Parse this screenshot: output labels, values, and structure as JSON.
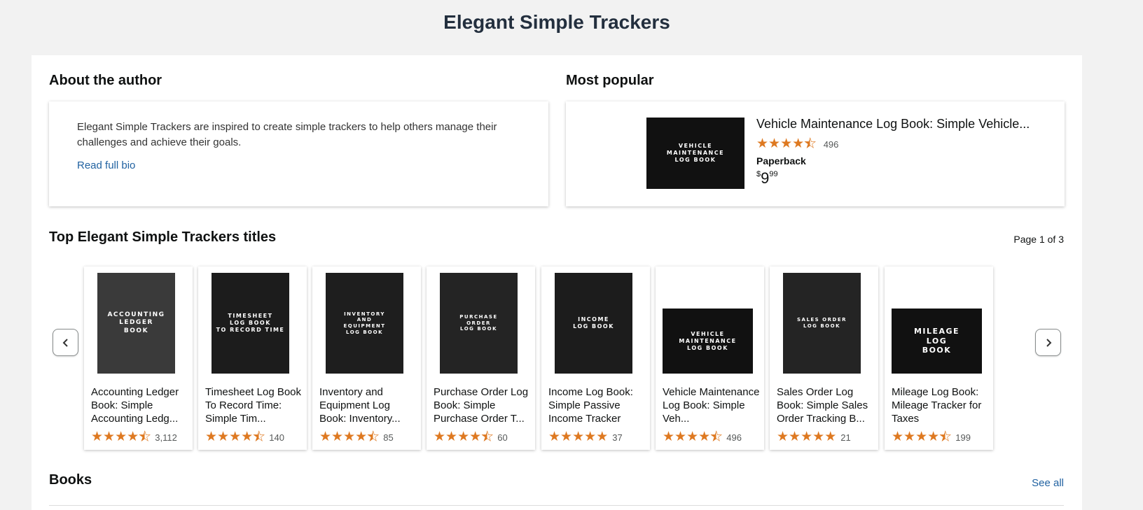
{
  "page_title": "Elegant Simple Trackers",
  "about": {
    "heading": "About the author",
    "bio": "Elegant Simple Trackers are inspired to create simple trackers to help others manage their challenges and achieve their goals.",
    "read_more": "Read full bio"
  },
  "most_popular": {
    "heading": "Most popular",
    "cover_text": "VEHICLE\nMAINTENANCE\nLOG BOOK",
    "title": "Vehicle Maintenance Log Book: Simple Vehicle...",
    "rating": 4.5,
    "rating_count": "496",
    "format": "Paperback",
    "price_symbol": "$",
    "price_whole": "9",
    "price_fraction": "99"
  },
  "top_titles": {
    "heading": "Top Elegant Simple Trackers titles",
    "page_indicator": "Page 1 of 3",
    "items": [
      {
        "title": "Accounting Ledger Book: Simple Accounting Ledg...",
        "cover_text": "ACCOUNTING\nLEDGER\nBOOK",
        "cover_color": "#3a3a3a",
        "rating": 4.5,
        "rating_count": "3,112"
      },
      {
        "title": "Timesheet Log Book To Record Time: Simple Tim...",
        "cover_text": "TIMESHEET\nLOG BOOK\nTO RECORD TIME",
        "cover_color": "#1c1c1c",
        "rating": 4.5,
        "rating_count": "140"
      },
      {
        "title": "Inventory and Equipment Log Book: Inventory...",
        "cover_text": "INVENTORY\nAND\nEQUIPMENT\nLOG BOOK",
        "cover_color": "#1e1e1e",
        "rating": 4.5,
        "rating_count": "85"
      },
      {
        "title": "Purchase Order Log Book: Simple Purchase Order T...",
        "cover_text": "PURCHASE\nORDER\nLOG BOOK",
        "cover_color": "#242424",
        "rating": 4.5,
        "rating_count": "60"
      },
      {
        "title": "Income Log Book: Simple Passive Income Tracker",
        "cover_text": "INCOME\nLOG BOOK",
        "cover_color": "#1c1c1c",
        "rating": 5,
        "rating_count": "37"
      },
      {
        "title": "Vehicle Maintenance Log Book: Simple Veh...",
        "cover_text": "VEHICLE\nMAINTENANCE\nLOG BOOK",
        "cover_color": "#111111",
        "rating": 4.5,
        "rating_count": "496"
      },
      {
        "title": "Sales Order Log Book: Simple Sales Order Tracking B...",
        "cover_text": "SALES ORDER\nLOG BOOK",
        "cover_color": "#242424",
        "rating": 5,
        "rating_count": "21"
      },
      {
        "title": "Mileage Log Book: Mileage Tracker for Taxes",
        "cover_text": "MILEAGE\nLOG\nBOOK",
        "cover_color": "#111111",
        "rating": 4.5,
        "rating_count": "199"
      }
    ]
  },
  "books": {
    "heading": "Books",
    "see_all": "See all"
  },
  "colors": {
    "star": "#de7921",
    "link": "#2162a1",
    "background": "#f2f2f2"
  }
}
